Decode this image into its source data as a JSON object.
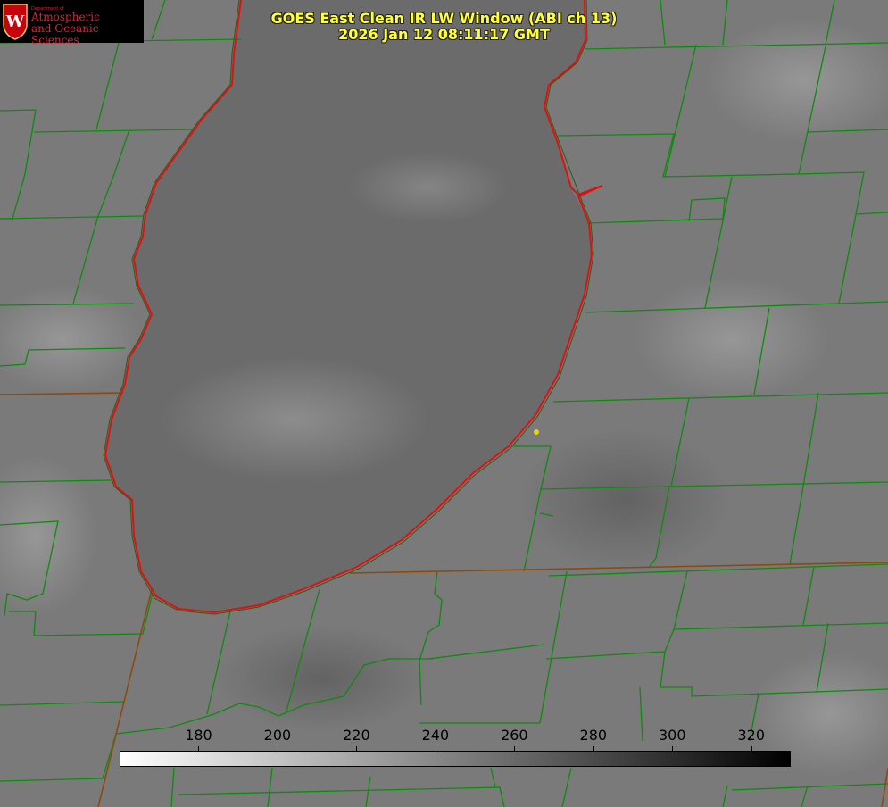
{
  "title": {
    "line1": "GOES East Clean IR LW Window (ABI ch 13)",
    "line2": "2026 Jan 12 08:11:17 GMT"
  },
  "logo": {
    "department": "Department of",
    "line1": "Atmospheric",
    "line2": "and Oceanic Sciences",
    "crest_letter": "W"
  },
  "colorbar": {
    "min": 160,
    "max": 330,
    "ticks": [
      "180",
      "200",
      "220",
      "240",
      "260",
      "280",
      "300",
      "320"
    ],
    "gradient_from": "#ffffff",
    "gradient_to": "#000000"
  },
  "colors": {
    "background": "#7a7a7a",
    "lake": "#6c6c6c",
    "county_lines": "#0f8a0f",
    "shoreline": "#e01010",
    "state_lines": "#8a4a10",
    "title_text": "#ffff33",
    "marker": "#e3d11a"
  }
}
